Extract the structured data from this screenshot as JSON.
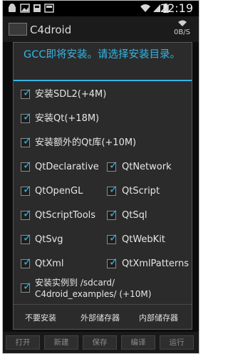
{
  "statusbar": {
    "time": "22:19",
    "icons": [
      "android-icon",
      "image-icon",
      "usb-icon",
      "flag-icon",
      "wifi-icon",
      "signal-icon",
      "battery-icon"
    ]
  },
  "appbar": {
    "title": "C4droid",
    "net_rate": "0B/S"
  },
  "dialog": {
    "title": "GCC即将安装。请选择安装目录。",
    "options_full": [
      {
        "label": "安装SDL2(+4M)",
        "checked": true
      },
      {
        "label": "安装Qt(+18M)",
        "checked": true
      },
      {
        "label": "安装额外的Qt库(+10M)",
        "checked": true
      }
    ],
    "options_grid": [
      {
        "label": "QtDeclarative",
        "checked": true
      },
      {
        "label": "QtNetwork",
        "checked": true
      },
      {
        "label": "QtOpenGL",
        "checked": true
      },
      {
        "label": "QtScript",
        "checked": true
      },
      {
        "label": "QtScriptTools",
        "checked": true
      },
      {
        "label": "QtSql",
        "checked": true
      },
      {
        "label": "QtSvg",
        "checked": true
      },
      {
        "label": "QtWebKit",
        "checked": true
      },
      {
        "label": "QtXml",
        "checked": true
      },
      {
        "label": "QtXmlPatterns",
        "checked": true
      }
    ],
    "examples": {
      "line1": "安装实例到 /sdcard/",
      "line2": "C4droid_examples/ (+10M)",
      "checked": true
    },
    "buttons": [
      "不要安装",
      "外部储存器",
      "内部储存器"
    ]
  },
  "bottombar": {
    "buttons": [
      "打开",
      "新建",
      "保存",
      "编译",
      "运行"
    ]
  },
  "colors": {
    "accent": "#33b5e5",
    "dialog_bg": "#2b2b2b"
  }
}
